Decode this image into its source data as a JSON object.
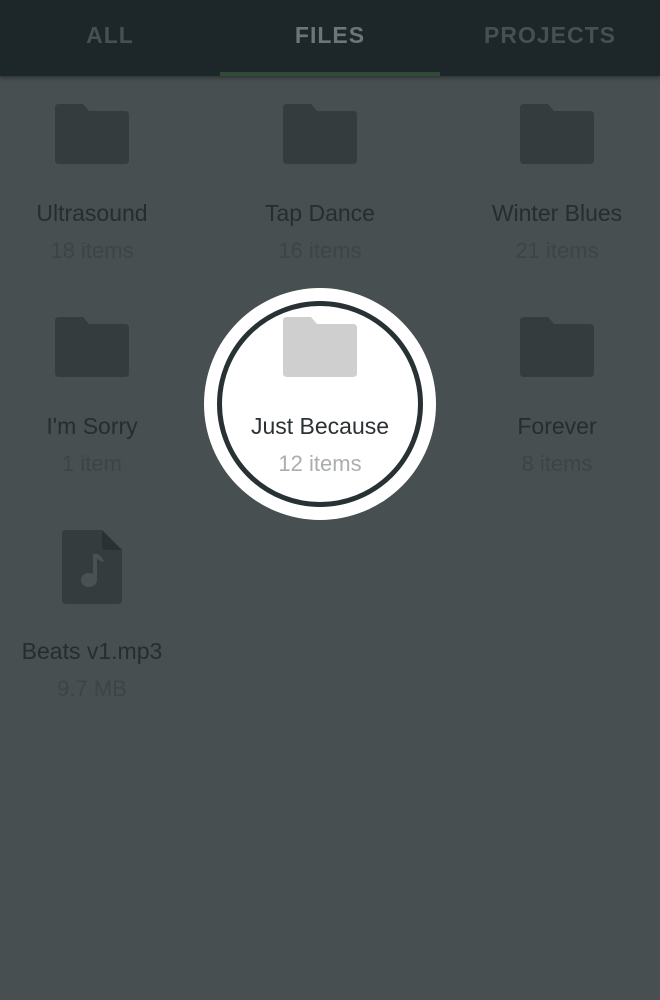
{
  "tabs": [
    {
      "label": "ALL",
      "selected": false
    },
    {
      "label": "FILES",
      "selected": true
    },
    {
      "label": "PROJECTS",
      "selected": false
    }
  ],
  "items": [
    {
      "name": "Ultrasound",
      "meta": "18 items",
      "icon": "folder-icon"
    },
    {
      "name": "Tap Dance",
      "meta": "16 items",
      "icon": "folder-icon"
    },
    {
      "name": "Winter Blues",
      "meta": "21 items",
      "icon": "folder-icon"
    },
    {
      "name": "I'm Sorry",
      "meta": "1 item",
      "icon": "folder-icon"
    },
    {
      "name": "Just Because",
      "meta": "12 items",
      "icon": "folder-icon",
      "highlighted": true
    },
    {
      "name": "Forever",
      "meta": "8 items",
      "icon": "folder-icon"
    },
    {
      "name": "Beats v1.mp3",
      "meta": "9.7 MB",
      "icon": "audio-file-icon"
    }
  ],
  "colors": {
    "overlay": "#484f50",
    "tabbar": "#1d2628",
    "icon_dim": "#353c3e",
    "icon_highlight": "#cfcfcf"
  }
}
